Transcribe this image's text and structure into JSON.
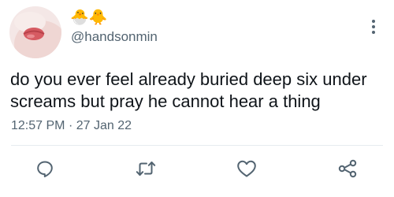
{
  "tweet": {
    "author": {
      "display_name": "🐣🐥",
      "handle": "@handsonmin"
    },
    "text": "do you ever feel already buried deep six under screams but pray he cannot hear a thing",
    "time": "12:57 PM",
    "separator": "·",
    "date": "27 Jan 22"
  },
  "icons": {
    "more": "more-vertical-icon",
    "reply": "reply-icon",
    "retweet": "retweet-icon",
    "like": "like-icon",
    "share": "share-icon"
  },
  "colors": {
    "text": "#0f1419",
    "secondary_text": "#536471",
    "icon": "#536471",
    "divider": "#e6ecf0"
  }
}
